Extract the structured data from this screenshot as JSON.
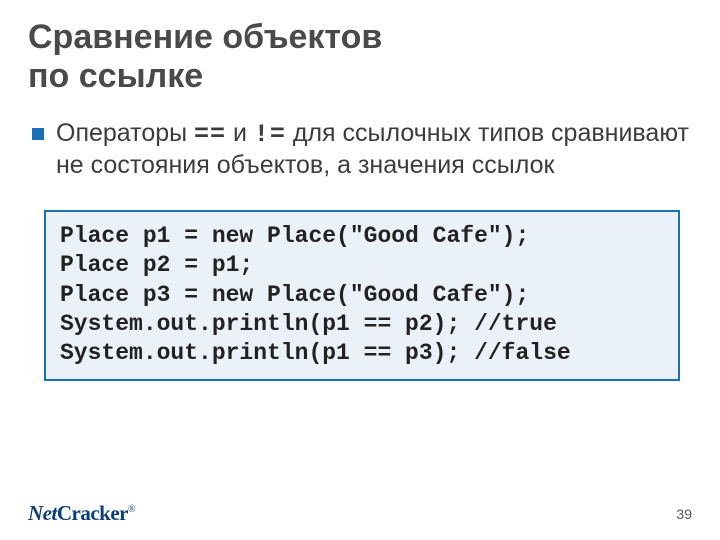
{
  "title_line1": "Сравнение объектов",
  "title_line2": "по ссылке",
  "bullet": {
    "part1": "Операторы ",
    "op1": "==",
    "part2": " и ",
    "op2": "!=",
    "part3": " для ссылочных типов сравнивают не состояния объектов, а значения ссылок"
  },
  "code": "Place p1 = new Place(\"Good Cafe\");\nPlace p2 = p1;\nPlace p3 = new Place(\"Good Cafe\");\nSystem.out.println(p1 == p2); //true\nSystem.out.println(p1 == p3); //false",
  "logo": {
    "net": "Net",
    "cracker": "Cracker",
    "reg": "®"
  },
  "page_number": "39"
}
